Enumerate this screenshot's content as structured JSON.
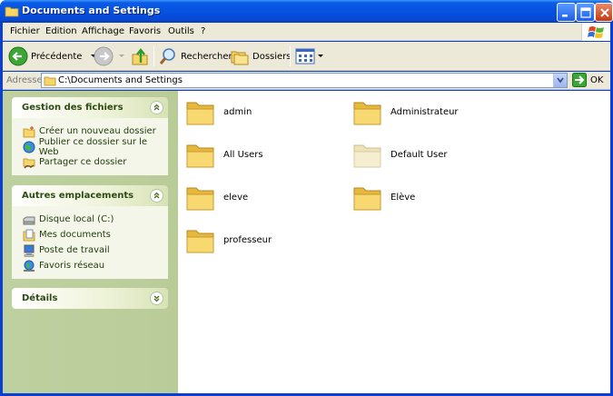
{
  "window": {
    "title": "Documents and Settings"
  },
  "menu": [
    "Fichier",
    "Edition",
    "Affichage",
    "Favoris",
    "Outils",
    "?"
  ],
  "toolbar": {
    "back_label": "Précédente",
    "search_label": "Rechercher",
    "folders_label": "Dossiers"
  },
  "address": {
    "label": "Adresse",
    "value": "C:\\Documents and Settings",
    "go_label": "OK"
  },
  "sidebar": {
    "file_tasks": {
      "title": "Gestion des fichiers",
      "items": [
        "Créer un nouveau dossier",
        "Publier ce dossier sur le Web",
        "Partager ce dossier"
      ]
    },
    "other_places": {
      "title": "Autres emplacements",
      "items": [
        "Disque local (C:)",
        "Mes documents",
        "Poste de travail",
        "Favoris réseau"
      ]
    },
    "details": {
      "title": "Détails"
    }
  },
  "files": [
    "admin",
    "Administrateur",
    "All Users",
    "Default User",
    "eleve",
    "Elève",
    "professeur"
  ],
  "colors": {
    "title_blue": "#0553e0",
    "folder_yellow": "#f6d66a",
    "sidebar_green": "#bfd0a0"
  }
}
